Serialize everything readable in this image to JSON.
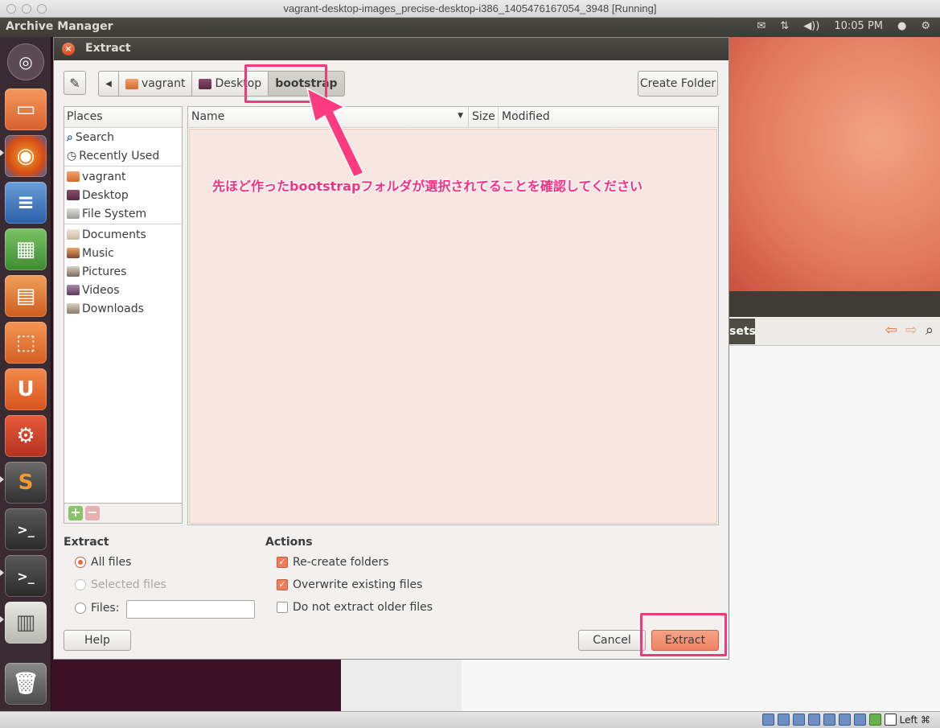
{
  "host": {
    "window_title": "vagrant-desktop-images_precise-desktop-i386_1405476167054_3948 [Running]",
    "status_right": "Left ⌘"
  },
  "panel": {
    "app_title": "Archive Manager",
    "time": "10:05 PM",
    "icons": [
      "mail-icon",
      "network-icon",
      "volume-icon",
      "user-icon",
      "power-icon"
    ]
  },
  "launcher": {
    "items": [
      "dash",
      "files",
      "firefox",
      "writer",
      "calc",
      "impress",
      "software-center",
      "ubuntu-one",
      "system-settings",
      "sublime-text",
      "terminal",
      "terminal",
      "archive-manager",
      "trash"
    ]
  },
  "background_window": {
    "toolbar_fragment": "sets"
  },
  "dialog": {
    "title": "Extract",
    "create_folder_label": "Create Folder",
    "path": [
      {
        "label": "vagrant",
        "icon": "home-folder-icon"
      },
      {
        "label": "Desktop",
        "icon": "desktop-icon"
      },
      {
        "label": "bootstrap",
        "icon": ""
      }
    ],
    "places_header": "Places",
    "places": [
      {
        "label": "Search",
        "icon": "search-icon"
      },
      {
        "label": "Recently Used",
        "icon": "recent-icon"
      },
      {
        "label": "vagrant",
        "icon": "home-folder-icon"
      },
      {
        "label": "Desktop",
        "icon": "desktop-icon"
      },
      {
        "label": "File System",
        "icon": "drive-icon"
      },
      {
        "label": "Documents",
        "icon": "documents-folder-icon"
      },
      {
        "label": "Music",
        "icon": "music-folder-icon"
      },
      {
        "label": "Pictures",
        "icon": "pictures-folder-icon"
      },
      {
        "label": "Videos",
        "icon": "videos-folder-icon"
      },
      {
        "label": "Downloads",
        "icon": "downloads-folder-icon"
      }
    ],
    "columns": {
      "name": "Name",
      "size": "Size",
      "modified": "Modified"
    },
    "extract_section": {
      "title": "Extract",
      "all_files": "All files",
      "selected_files": "Selected files",
      "files": "Files:",
      "files_value": ""
    },
    "actions_section": {
      "title": "Actions",
      "recreate": "Re-create folders",
      "overwrite": "Overwrite existing files",
      "no_older": "Do not extract older files"
    },
    "help_label": "Help",
    "cancel_label": "Cancel",
    "extract_label": "Extract"
  },
  "annotation": {
    "text": "先ほど作ったbootstrapフォルダが選択されてることを確認してください",
    "color": "#ff2e7e"
  }
}
